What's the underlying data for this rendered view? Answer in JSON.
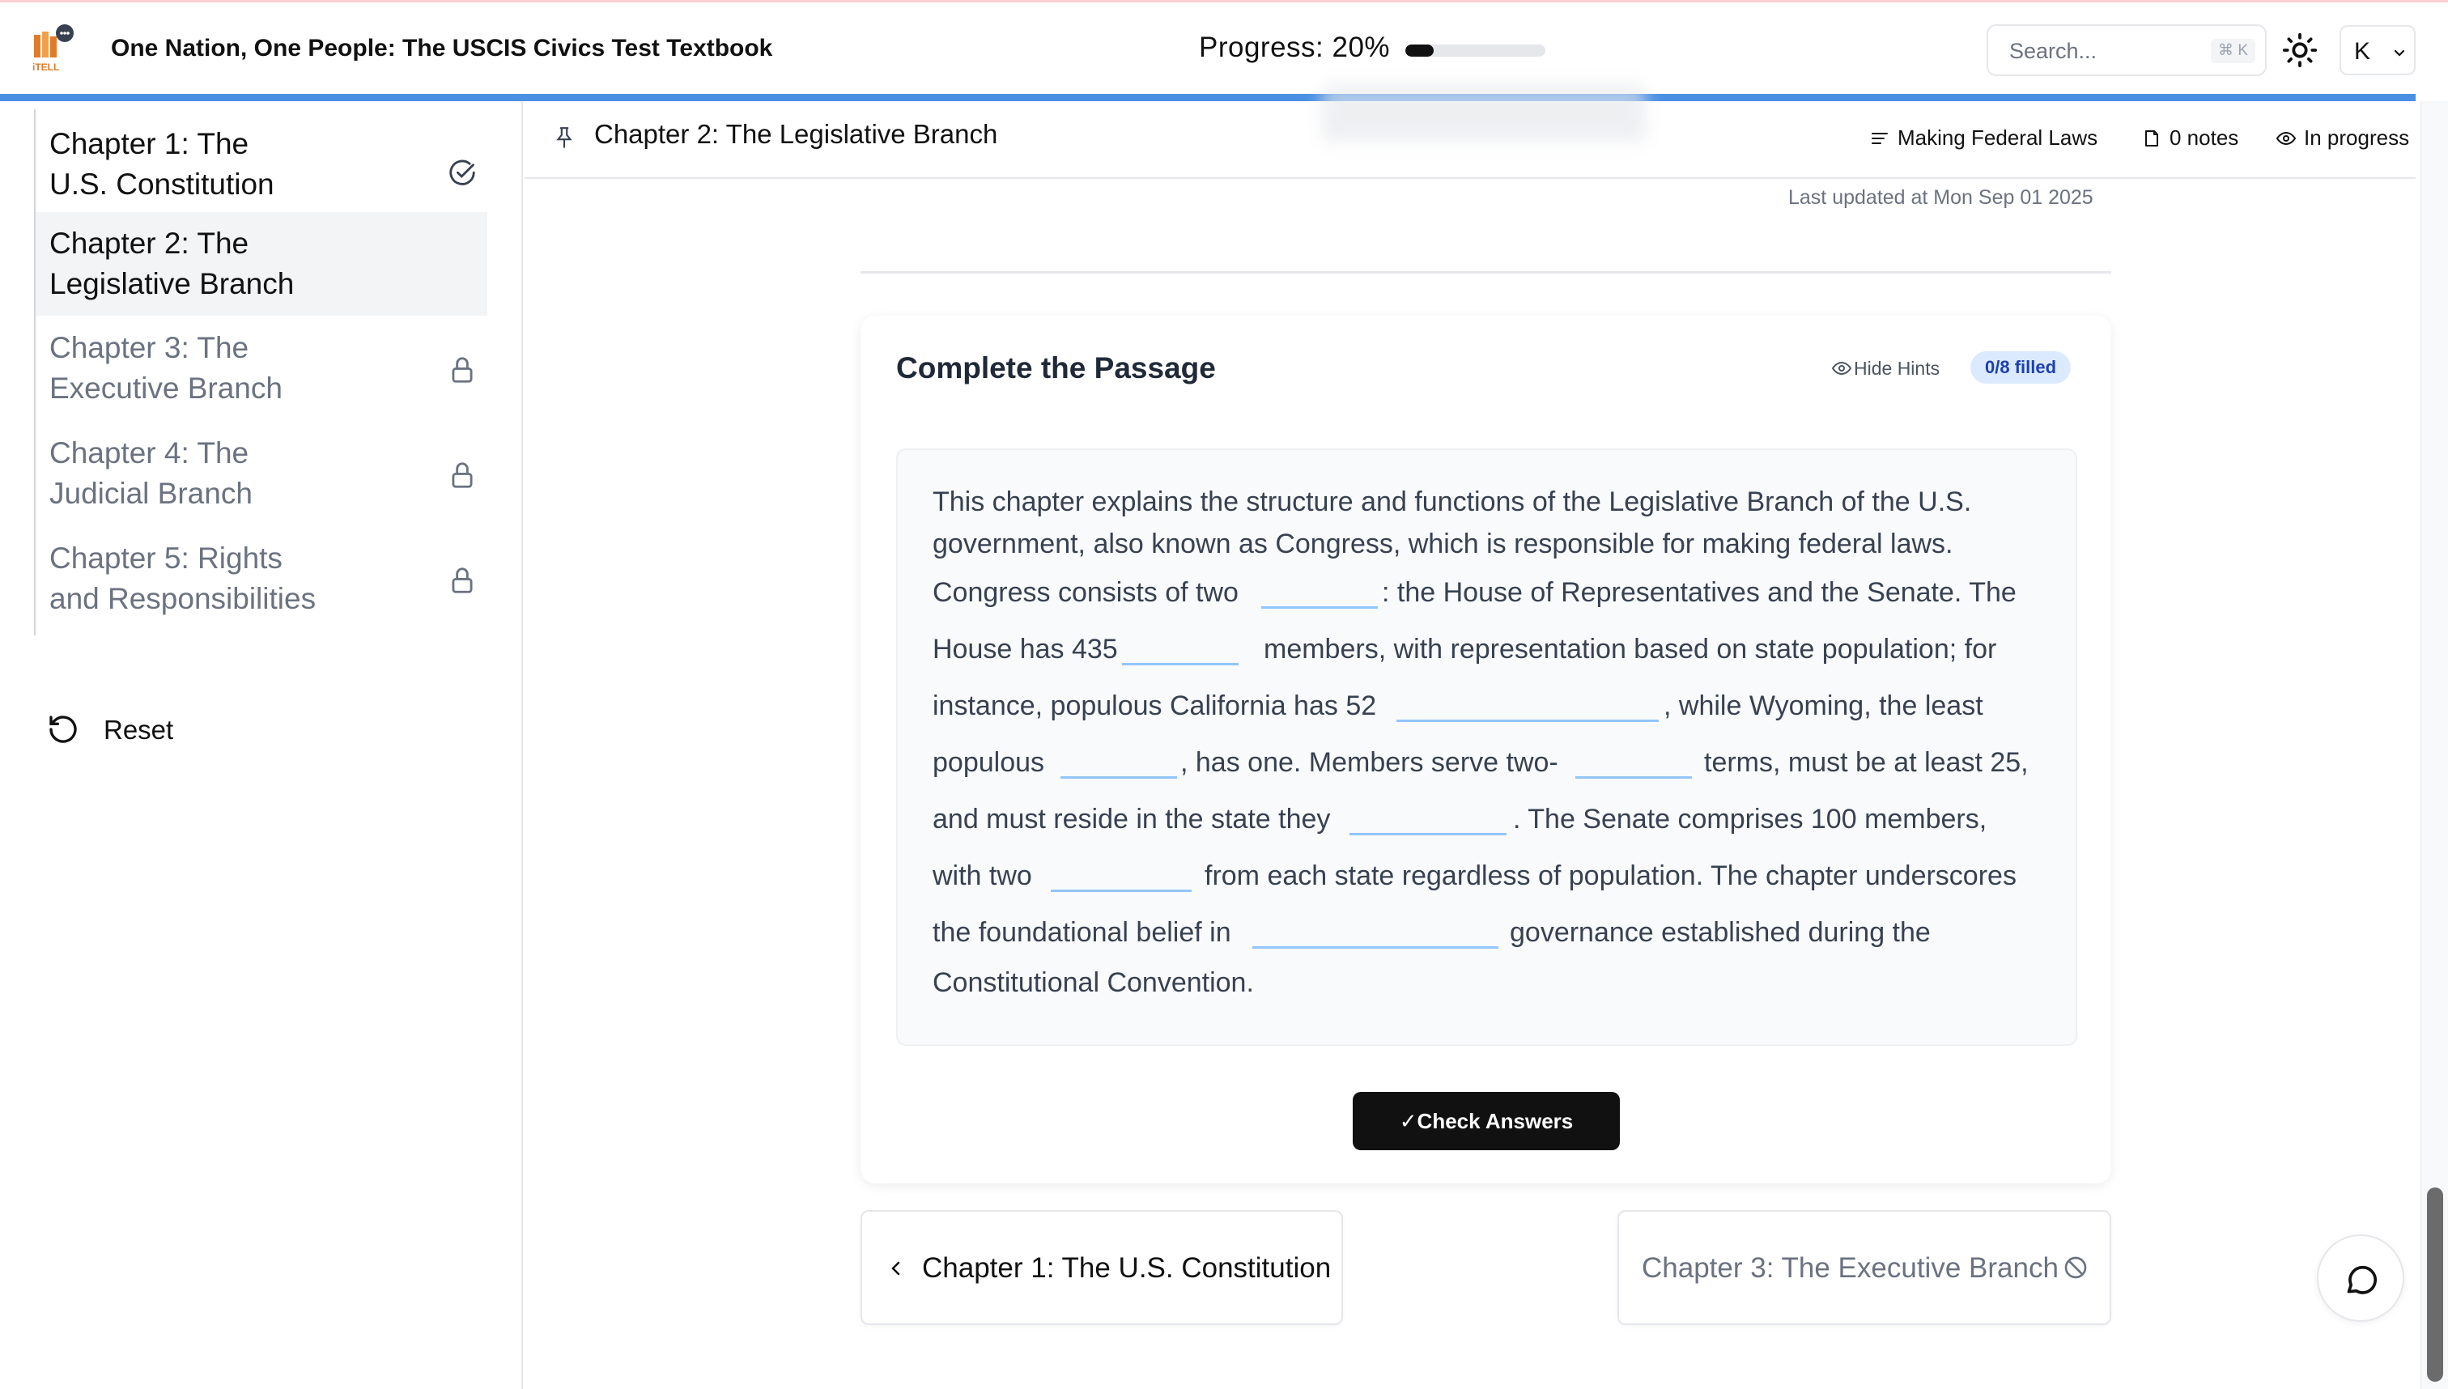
{
  "header": {
    "site_title": "One Nation, One People: The USCIS Civics Test Textbook",
    "logo_text": "iTELL",
    "progress_label": "Progress:  20%",
    "progress_fraction": 0.2,
    "search_placeholder": "Search...",
    "search_shortcut": "⌘ K",
    "theme_icon": "sun-icon",
    "user_initial": "K"
  },
  "sidebar": {
    "chapters": [
      {
        "label": "Chapter 1: The\nU.S. Constitution",
        "status": "completed",
        "icon": "check-circle-icon"
      },
      {
        "label": "Chapter 2: The\nLegislative Branch",
        "status": "current"
      },
      {
        "label": "Chapter 3: The\nExecutive Branch",
        "status": "locked",
        "icon": "lock-icon"
      },
      {
        "label": "Chapter 4: The\nJudicial Branch",
        "status": "locked",
        "icon": "lock-icon"
      },
      {
        "label": "Chapter 5: Rights\nand Responsibilities",
        "status": "locked",
        "icon": "lock-icon"
      }
    ],
    "reset_label": "Reset"
  },
  "chapter_bar": {
    "title": "Chapter 2: The Legislative Branch",
    "section_label": "Making Federal Laws",
    "notes_label": "0 notes",
    "status_label": "In progress"
  },
  "main": {
    "last_updated": "Last updated at Mon Sep 01 2025"
  },
  "exercise": {
    "title": "Complete the Passage",
    "hide_hints_label": "Hide Hints",
    "filled_badge": "0/8 filled",
    "passage_lines": [
      "This chapter explains the structure and functions of the Legislative Branch of the U.S.",
      "government, also known as Congress, which is responsible for making federal laws.",
      "Congress consists of two",
      ": the House of Representatives and the Senate. The",
      "House has 435",
      "members, with representation based on state population; for",
      "instance, populous California has 52",
      ", while Wyoming, the least",
      "populous",
      ", has one. Members serve two-",
      "terms, must be at least 25,",
      "and must reside in the state they",
      ". The Senate comprises 100 members,",
      "with two",
      "from each state regardless of population. The chapter underscores",
      "the foundational belief in",
      "governance established during the",
      "Constitutional Convention."
    ],
    "check_label": "✓Check Answers"
  },
  "pagination": {
    "prev_label": "Chapter 1: The U.S. Constitution",
    "next_label": "Chapter 3: The Executive Branch"
  },
  "colors": {
    "accent_blue": "#4a90e2",
    "badge_bg": "#dbeafe",
    "badge_text": "#1e40af",
    "blank_underline": "#93c5fd",
    "logo_orange": "#e07b2a"
  }
}
